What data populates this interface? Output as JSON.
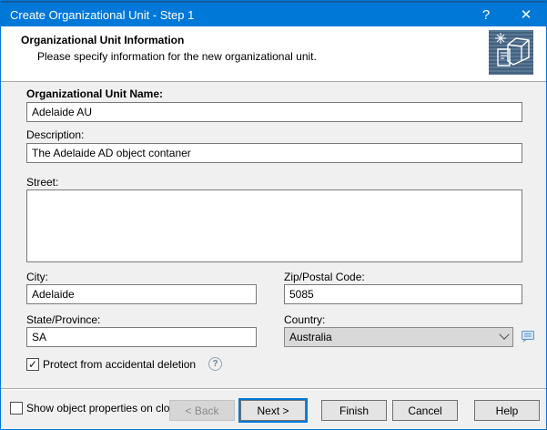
{
  "window": {
    "title": "Create Organizational Unit - Step 1",
    "help_glyph": "?",
    "close_glyph": "✕"
  },
  "header": {
    "title": "Organizational Unit Information",
    "subtitle": "Please specify information for the new organizational unit.",
    "icon": "new-organizational-unit-icon"
  },
  "form": {
    "ou_name": {
      "label": "Organizational Unit Name:",
      "value": "Adelaide AU"
    },
    "description": {
      "label": "Description:",
      "value": "The Adelaide AD object contaner"
    },
    "street": {
      "label": "Street:",
      "value": ""
    },
    "city": {
      "label": "City:",
      "value": "Adelaide"
    },
    "zip": {
      "label": "Zip/Postal Code:",
      "value": "5085"
    },
    "state": {
      "label": "State/Province:",
      "value": "SA"
    },
    "country": {
      "label": "Country:",
      "value": "Australia"
    },
    "protect_checkbox": {
      "label": "Protect from accidental deletion",
      "checked": true
    }
  },
  "footer": {
    "show_properties_checkbox": {
      "label": "Show object properties on close",
      "checked": false
    },
    "buttons": [
      {
        "label": "< Back",
        "state": "disabled"
      },
      {
        "label": "Next >",
        "state": "default"
      },
      {
        "label": "Finish",
        "state": "normal"
      },
      {
        "label": "Cancel",
        "state": "normal"
      },
      {
        "label": "Help",
        "state": "normal"
      }
    ]
  },
  "icons": {
    "check_glyph": "✓",
    "field_help_glyph": "?"
  },
  "colors": {
    "titlebar": "#0078D7",
    "accent": "#0078D7",
    "form_background": "#F0F0F0",
    "header_background": "#FFFFFF",
    "combo_background": "#D9D9D9",
    "icon_tile_background": "#44617F"
  }
}
